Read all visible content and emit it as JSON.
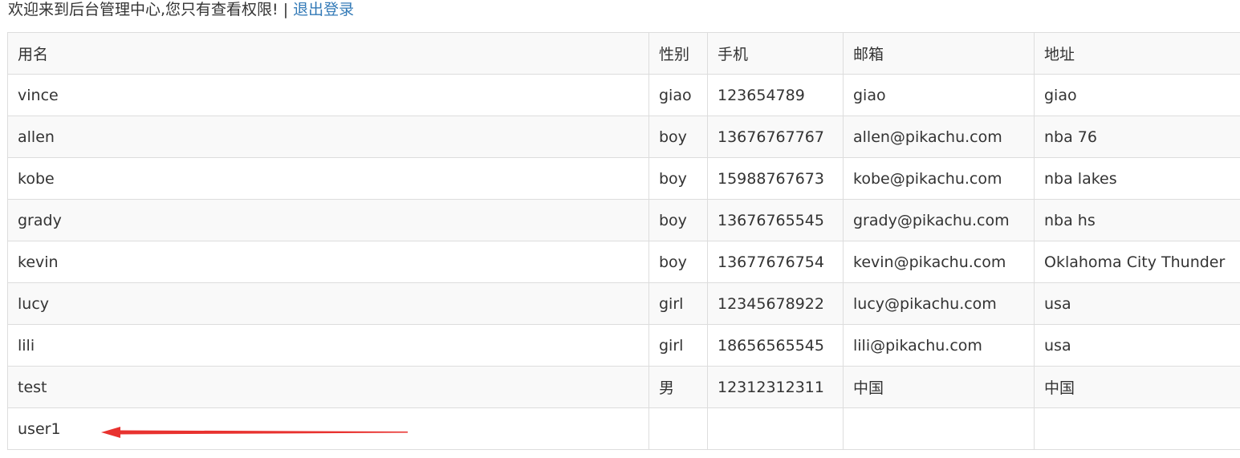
{
  "header": {
    "welcome_text": "欢迎来到后台管理中心,您只有查看权限! | ",
    "logout_label": "退出登录"
  },
  "table": {
    "columns": [
      "用名",
      "性别",
      "手机",
      "邮箱",
      "地址"
    ],
    "rows": [
      {
        "username": "vince",
        "gender": "giao",
        "phone": "123654789",
        "email": "giao",
        "address": "giao"
      },
      {
        "username": "allen",
        "gender": "boy",
        "phone": "13676767767",
        "email": "allen@pikachu.com",
        "address": "nba 76"
      },
      {
        "username": "kobe",
        "gender": "boy",
        "phone": "15988767673",
        "email": "kobe@pikachu.com",
        "address": "nba lakes"
      },
      {
        "username": "grady",
        "gender": "boy",
        "phone": "13676765545",
        "email": "grady@pikachu.com",
        "address": "nba hs"
      },
      {
        "username": "kevin",
        "gender": "boy",
        "phone": "13677676754",
        "email": "kevin@pikachu.com",
        "address": "Oklahoma City Thunder"
      },
      {
        "username": "lucy",
        "gender": "girl",
        "phone": "12345678922",
        "email": "lucy@pikachu.com",
        "address": "usa"
      },
      {
        "username": "lili",
        "gender": "girl",
        "phone": "18656565545",
        "email": "lili@pikachu.com",
        "address": "usa"
      },
      {
        "username": "test",
        "gender": "男",
        "phone": "12312312311",
        "email": "中国",
        "address": "中国"
      },
      {
        "username": "user1",
        "gender": "",
        "phone": "",
        "email": "",
        "address": ""
      }
    ]
  },
  "annotation": {
    "arrow_color": "#e8322f"
  }
}
